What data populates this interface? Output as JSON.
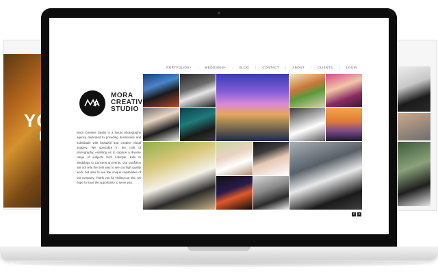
{
  "background_slides": {
    "left": {
      "headline": "YO",
      "subline": "I'"
    }
  },
  "site": {
    "nav": [
      {
        "label": "PORTFOLIOS+"
      },
      {
        "label": "WEDDINGS+"
      },
      {
        "label": "BLOG"
      },
      {
        "label": "CONTACT"
      },
      {
        "label": "ABOUT"
      },
      {
        "label": "CLIENTS"
      },
      {
        "label": "LOGIN"
      }
    ],
    "logo": {
      "mark": "MA",
      "icon": "mora-monogram-icon"
    },
    "brand": [
      "MORA",
      "CREATIVE",
      "STUDIO"
    ],
    "about": "Mora Creative Studio is a luxury photography agency dedicated to providing businesses and individuals with beautiful and creative visual imagery. We specialize in the craft of photography, enabling us to capture a diverse range of subjects from Lifestyle, Kids to Weddings to Concerts & Events. Our portfolios are not only the best way to see our high quality work, but also to see the unique capabilities of our company. Thank you for visiting our site, we hope to have the opportunity to serve you.",
    "social": [
      {
        "icon": "facebook-icon",
        "glyph": "f"
      },
      {
        "icon": "twitter-icon",
        "glyph": "t"
      }
    ]
  },
  "colors": {
    "bezel": "#0d0d0d",
    "logo_bg": "#111111",
    "nav_text": "#555555"
  }
}
